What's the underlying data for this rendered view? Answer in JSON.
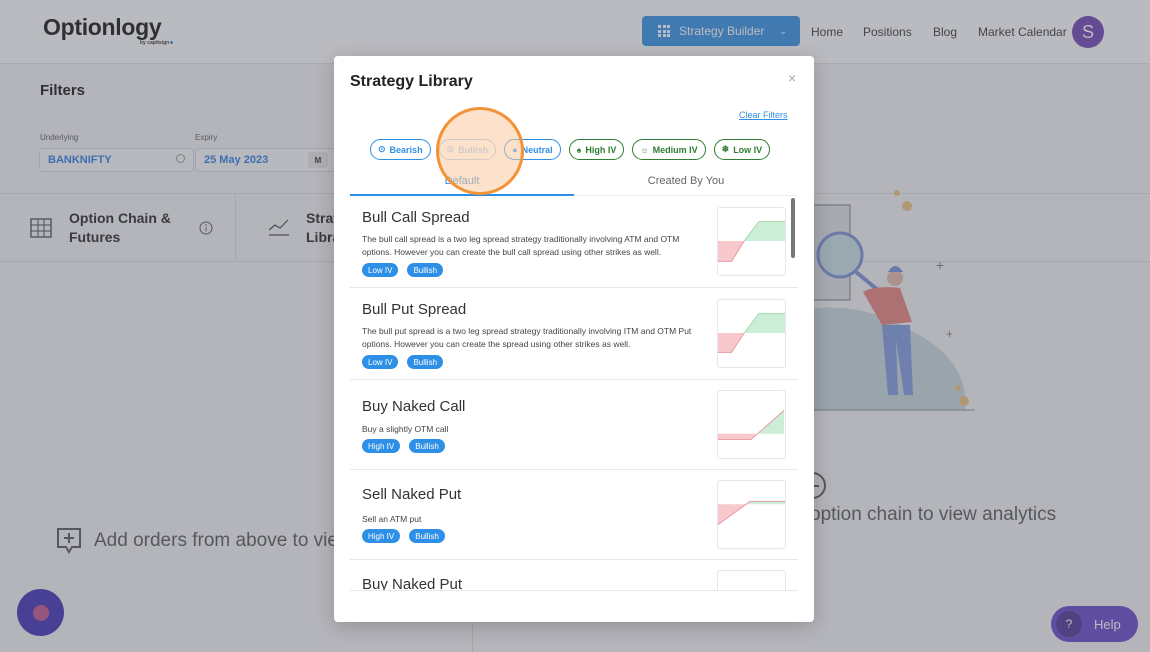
{
  "header": {
    "logo": "Optionlogy",
    "logo_sub": "by capitsign",
    "strategy_builder_label": "Strategy Builder",
    "nav": [
      "Home",
      "Positions",
      "Blog",
      "Market Calendar"
    ],
    "avatar_initial": "S"
  },
  "filters": {
    "title": "Filters",
    "underlying_label": "Underlying",
    "underlying_value": "BANKNIFTY",
    "expiry_label": "Expiry",
    "expiry_value": "25 May 2023",
    "expiry_badge": "M"
  },
  "page_tabs": {
    "option_chain": "Option Chain & Futures",
    "option_chain_line1": "Option Chain &",
    "option_chain_line2": "Futures",
    "strategy_line1": "Strategy",
    "strategy_line2": "Library"
  },
  "empty_states": {
    "left": "Add orders from above to view",
    "right": "option chain to view analytics"
  },
  "help_label": "Help",
  "help_icon": "?",
  "modal": {
    "title": "Strategy Library",
    "close": "×",
    "clear_filters": "Clear Filters",
    "chips": [
      {
        "label": "Bearish",
        "icon": "⊙",
        "style": "blue"
      },
      {
        "label": "Bullish",
        "icon": "⊙",
        "style": "blue"
      },
      {
        "label": "Neutral",
        "icon": "●",
        "style": "blue"
      },
      {
        "label": "High IV",
        "icon": "♠",
        "style": "green"
      },
      {
        "label": "Medium IV",
        "icon": "☼",
        "style": "green"
      },
      {
        "label": "Low IV",
        "icon": "❄",
        "style": "green"
      }
    ],
    "tabs": [
      {
        "label": "Default",
        "active": true
      },
      {
        "label": "Created By You",
        "active": false
      }
    ],
    "strategies": [
      {
        "title": "Bull Call Spread",
        "description": "The bull call spread is a two leg spread strategy traditionally involving ATM and OTM options. However you can create the bull call spread using other strikes as well.",
        "tags": [
          "Low IV",
          "Bullish"
        ]
      },
      {
        "title": "Bull Put Spread",
        "description": "The bull put spread is a two leg spread strategy traditionally involving ITM and OTM Put options. However you can create the spread using other strikes as well.",
        "tags": [
          "Low IV",
          "Bullish"
        ]
      },
      {
        "title": "Buy Naked Call",
        "description": "Buy a slightly OTM call",
        "tags": [
          "High IV",
          "Bullish"
        ]
      },
      {
        "title": "Sell Naked Put",
        "description": "Sell an ATM put",
        "tags": [
          "High IV",
          "Bullish"
        ]
      },
      {
        "title": "Buy Naked Put",
        "description": "",
        "tags": []
      }
    ]
  },
  "colors": {
    "accent": "#2e8fe6",
    "iv_green": "#2e7d32",
    "profit": "#cdeed6",
    "loss": "#f7c9cc",
    "highlight_ring": "#f39237"
  }
}
